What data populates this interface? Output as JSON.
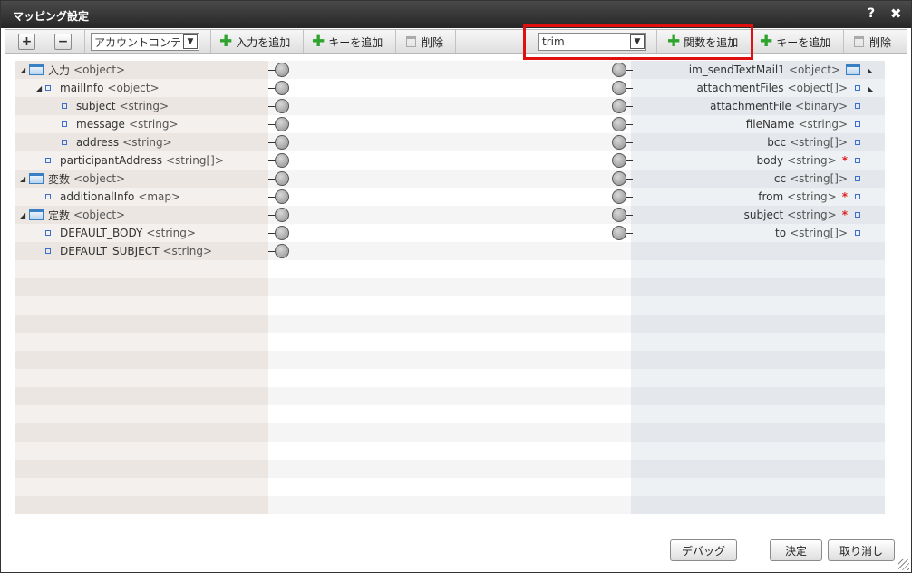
{
  "window": {
    "title": "マッピング設定",
    "help": "?",
    "close": "✖"
  },
  "toolbar": {
    "expand": "+",
    "collapse": "−",
    "context_select": "アカウントコンテ",
    "add_input": "入力を追加",
    "add_key_left": "キーを追加",
    "delete_left": "削除",
    "function_select": "trim",
    "add_function": "関数を追加",
    "add_key_right": "キーを追加",
    "delete_right": "削除"
  },
  "input_tree": [
    {
      "level": 0,
      "expander": "◢",
      "kind": "folder",
      "name": "入力",
      "type": "<object>"
    },
    {
      "level": 1,
      "expander": "◢",
      "kind": "leaf",
      "name": "mailInfo",
      "type": "<object>"
    },
    {
      "level": 2,
      "expander": "",
      "kind": "leaf",
      "name": "subject",
      "type": "<string>"
    },
    {
      "level": 2,
      "expander": "",
      "kind": "leaf",
      "name": "message",
      "type": "<string>"
    },
    {
      "level": 2,
      "expander": "",
      "kind": "leaf",
      "name": "address",
      "type": "<string>"
    },
    {
      "level": 1,
      "expander": "",
      "kind": "leaf",
      "name": "participantAddress",
      "type": "<string[]>"
    },
    {
      "level": 0,
      "expander": "◢",
      "kind": "folder",
      "name": "変数",
      "type": "<object>"
    },
    {
      "level": 1,
      "expander": "",
      "kind": "leaf",
      "name": "additionalInfo",
      "type": "<map>"
    },
    {
      "level": 0,
      "expander": "◢",
      "kind": "folder",
      "name": "定数",
      "type": "<object>"
    },
    {
      "level": 1,
      "expander": "",
      "kind": "leaf",
      "name": "DEFAULT_BODY",
      "type": "<string>"
    },
    {
      "level": 1,
      "expander": "",
      "kind": "leaf",
      "name": "DEFAULT_SUBJECT",
      "type": "<string>"
    }
  ],
  "output_tree": [
    {
      "name": "im_sendTextMail1",
      "type": "<object>",
      "required": "",
      "kind": "folder",
      "expander": "◣"
    },
    {
      "name": "attachmentFiles",
      "type": "<object[]>",
      "required": "",
      "kind": "leaf",
      "expander": "◣"
    },
    {
      "name": "attachmentFile",
      "type": "<binary>",
      "required": "",
      "kind": "leaf",
      "expander": ""
    },
    {
      "name": "fileName",
      "type": "<string>",
      "required": "",
      "kind": "leaf",
      "expander": ""
    },
    {
      "name": "bcc",
      "type": "<string[]>",
      "required": "",
      "kind": "leaf",
      "expander": ""
    },
    {
      "name": "body",
      "type": "<string>",
      "required": "*",
      "kind": "leaf",
      "expander": ""
    },
    {
      "name": "cc",
      "type": "<string[]>",
      "required": "",
      "kind": "leaf",
      "expander": ""
    },
    {
      "name": "from",
      "type": "<string>",
      "required": "*",
      "kind": "leaf",
      "expander": ""
    },
    {
      "name": "subject",
      "type": "<string>",
      "required": "*",
      "kind": "leaf",
      "expander": ""
    },
    {
      "name": "to",
      "type": "<string[]>",
      "required": "",
      "kind": "leaf",
      "expander": ""
    }
  ],
  "footer": {
    "debug": "デバッグ",
    "ok": "決定",
    "cancel": "取り消し"
  },
  "colors": {
    "highlight": "#e01010",
    "add_icon": "#2ea42e",
    "required": "#e02020"
  }
}
